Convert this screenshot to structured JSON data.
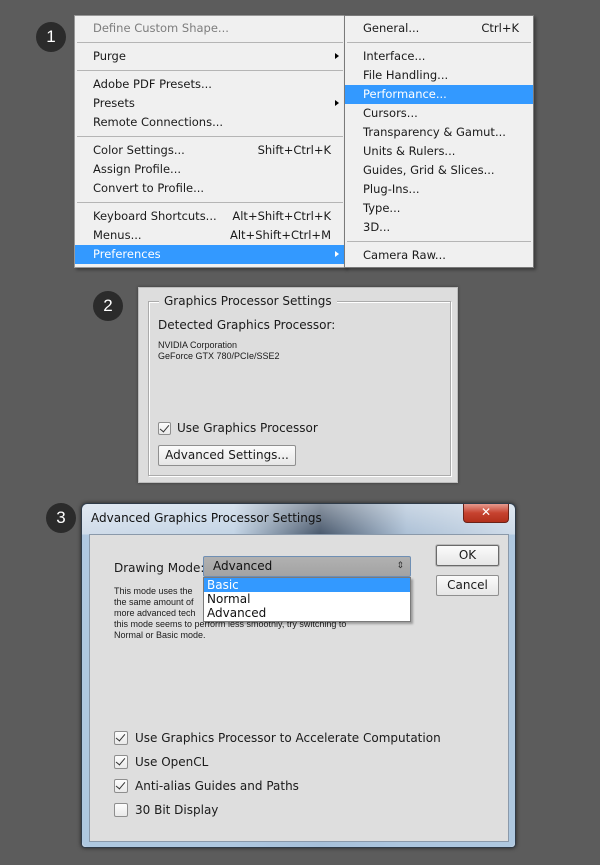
{
  "steps": [
    "1",
    "2",
    "3"
  ],
  "edit_menu": {
    "items": [
      {
        "label": "Define Custom Shape...",
        "disabled": true
      },
      {
        "separator": true
      },
      {
        "label": "Purge",
        "submenu": true
      },
      {
        "separator": true
      },
      {
        "label": "Adobe PDF Presets..."
      },
      {
        "label": "Presets",
        "submenu": true
      },
      {
        "label": "Remote Connections..."
      },
      {
        "separator": true
      },
      {
        "label": "Color Settings...",
        "shortcut": "Shift+Ctrl+K"
      },
      {
        "label": "Assign Profile..."
      },
      {
        "label": "Convert to Profile..."
      },
      {
        "separator": true
      },
      {
        "label": "Keyboard Shortcuts...",
        "shortcut": "Alt+Shift+Ctrl+K"
      },
      {
        "label": "Menus...",
        "shortcut": "Alt+Shift+Ctrl+M"
      },
      {
        "label": "Preferences",
        "submenu": true,
        "highlighted": true
      }
    ]
  },
  "preferences_submenu": {
    "items": [
      {
        "label": "General...",
        "shortcut": "Ctrl+K"
      },
      {
        "separator": true
      },
      {
        "label": "Interface..."
      },
      {
        "label": "File Handling..."
      },
      {
        "label": "Performance...",
        "highlighted": true
      },
      {
        "label": "Cursors..."
      },
      {
        "label": "Transparency & Gamut..."
      },
      {
        "label": "Units & Rulers..."
      },
      {
        "label": "Guides, Grid & Slices..."
      },
      {
        "label": "Plug-Ins..."
      },
      {
        "label": "Type..."
      },
      {
        "label": "3D..."
      },
      {
        "separator": true
      },
      {
        "label": "Camera Raw..."
      }
    ]
  },
  "gpu_settings": {
    "group_title": "Graphics Processor Settings",
    "detected_label": "Detected Graphics Processor:",
    "gpu_vendor": "NVIDIA Corporation",
    "gpu_model": "GeForce GTX 780/PCIe/SSE2",
    "use_gpu_label": "Use Graphics Processor",
    "use_gpu_checked": true,
    "advanced_button": "Advanced Settings..."
  },
  "advanced_dialog": {
    "title": "Advanced Graphics Processor Settings",
    "close_glyph": "✕",
    "drawing_mode_label": "Drawing Mode:",
    "drawing_mode_value": "Advanced",
    "select_glyph": "⇕",
    "dropdown_options": [
      {
        "label": "Basic",
        "highlighted": true
      },
      {
        "label": "Normal"
      },
      {
        "label": "Advanced"
      }
    ],
    "description_lines": [
      "This mode uses the",
      "the same amount of",
      "more advanced tech",
      "this mode seems to perform less smoothly, try switching to",
      "Normal or Basic mode."
    ],
    "ok_button": "OK",
    "cancel_button": "Cancel",
    "options": [
      {
        "label": "Use Graphics Processor to Accelerate Computation",
        "checked": true
      },
      {
        "label": "Use OpenCL",
        "checked": true
      },
      {
        "label": "Anti-alias Guides and Paths",
        "checked": true
      },
      {
        "label": "30 Bit Display",
        "checked": false
      }
    ]
  }
}
